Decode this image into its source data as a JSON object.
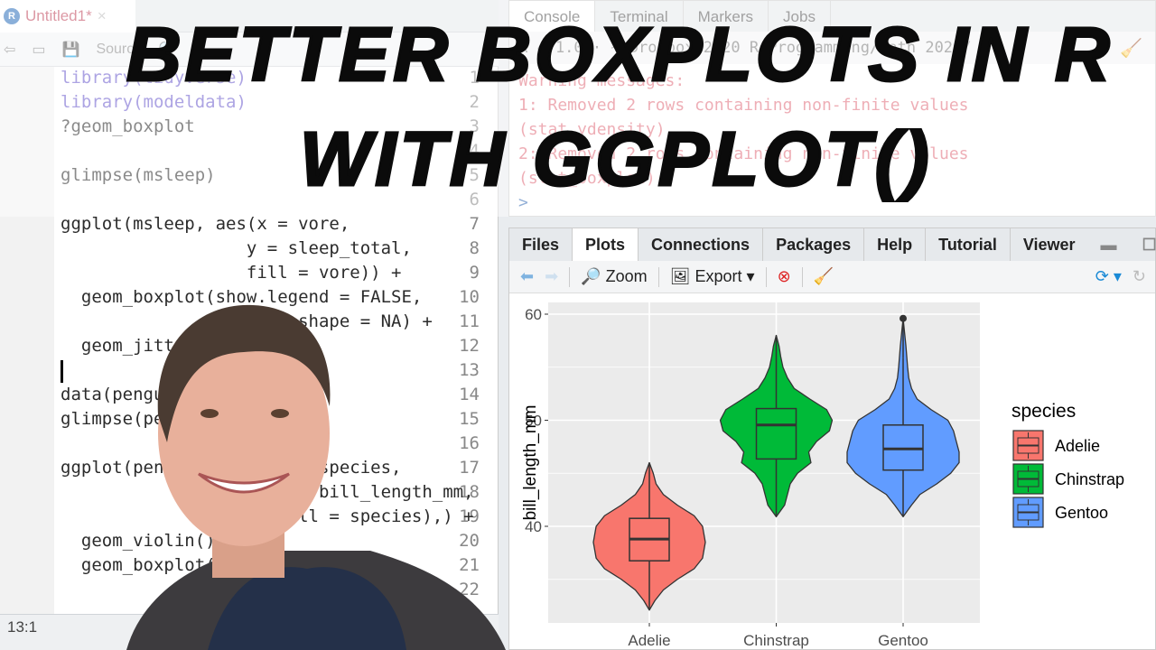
{
  "title": {
    "line1": "BETTER BOXPLOTS IN R",
    "line2": "WITH GGPLOT()"
  },
  "editor": {
    "tab_label": "Untitled1*",
    "r_icon": "R",
    "source_label": "Source",
    "lines": [
      {
        "n": "1",
        "code": "library(tidyverse)"
      },
      {
        "n": "2",
        "code": "library(modeldata)"
      },
      {
        "n": "3",
        "code": "?geom_boxplot"
      },
      {
        "n": "4",
        "code": ""
      },
      {
        "n": "5",
        "code": "glimpse(msleep)"
      },
      {
        "n": "6",
        "code": ""
      },
      {
        "n": "7",
        "code": "ggplot(msleep, aes(x = vore,"
      },
      {
        "n": "8",
        "code": "                  y = sleep_total,"
      },
      {
        "n": "9",
        "code": "                  fill = vore)) +"
      },
      {
        "n": "10",
        "code": "  geom_boxplot(show.legend = FALSE,"
      },
      {
        "n": "11",
        "code": "               outlier.shape = NA) +"
      },
      {
        "n": "12",
        "code": "  geom_jitter()"
      },
      {
        "n": "13",
        "code": ""
      },
      {
        "n": "14",
        "code": "data(penguins)"
      },
      {
        "n": "15",
        "code": "glimpse(penguins)"
      },
      {
        "n": "16",
        "code": ""
      },
      {
        "n": "17",
        "code": "ggplot(penguins, aes(x = species,"
      },
      {
        "n": "18",
        "code": "                     y = bill_length_mm,"
      },
      {
        "n": "19",
        "code": "                     fill = species),) +"
      },
      {
        "n": "20",
        "code": "  geom_violin() +"
      },
      {
        "n": "21",
        "code": "  geom_boxplot()"
      },
      {
        "n": "22",
        "code": ""
      }
    ],
    "cursor_position": "13:1"
  },
  "console": {
    "tabs": [
      "Console",
      "Terminal",
      "Markers",
      "Jobs"
    ],
    "path": "R 4.1.0 · ~/Dropbox/2020 R Programming/Math 2020/",
    "lines": [
      "Warning messages:",
      "1: Removed 2 rows containing non-finite values",
      "(stat_ydensity).",
      "2: Removed 2 rows containing non-finite values",
      "(stat_boxplot).",
      ">"
    ]
  },
  "plots_pane": {
    "tabs": [
      "Files",
      "Plots",
      "Connections",
      "Packages",
      "Help",
      "Tutorial",
      "Viewer"
    ],
    "active_tab": "Plots",
    "zoom_label": "Zoom",
    "export_label": "Export"
  },
  "chart_data": {
    "type": "violin+boxplot",
    "xlabel": "",
    "ylabel": "bill_length_mm",
    "ylim": [
      30.9,
      61.1
    ],
    "yticks": [
      "40",
      "50",
      "60"
    ],
    "legend": {
      "title": "species",
      "position": "right"
    },
    "categories": [
      "Adelie",
      "Chinstrap",
      "Gentoo"
    ],
    "colors": [
      "#F8766D",
      "#00BA38",
      "#619CFF"
    ],
    "series": [
      {
        "name": "Adelie",
        "min": 32.1,
        "q1": 36.75,
        "median": 38.8,
        "q3": 40.75,
        "max": 46.0,
        "outliers": [],
        "density": [
          [
            32.1,
            0
          ],
          [
            33,
            0.1
          ],
          [
            34,
            0.25
          ],
          [
            35,
            0.5
          ],
          [
            36,
            0.8
          ],
          [
            37,
            0.95
          ],
          [
            38.5,
            1
          ],
          [
            40,
            0.95
          ],
          [
            41,
            0.8
          ],
          [
            42,
            0.5
          ],
          [
            43,
            0.25
          ],
          [
            44,
            0.12
          ],
          [
            45,
            0.07
          ],
          [
            46,
            0
          ]
        ]
      },
      {
        "name": "Chinstrap",
        "min": 40.9,
        "q1": 46.35,
        "median": 49.55,
        "q3": 51.1,
        "max": 58.0,
        "outliers": [],
        "density": [
          [
            40.9,
            0
          ],
          [
            42,
            0.15
          ],
          [
            43,
            0.2
          ],
          [
            44,
            0.25
          ],
          [
            45,
            0.38
          ],
          [
            46,
            0.62
          ],
          [
            47,
            0.58
          ],
          [
            48,
            0.72
          ],
          [
            49,
            0.95
          ],
          [
            50,
            1
          ],
          [
            51,
            0.9
          ],
          [
            52,
            0.6
          ],
          [
            53,
            0.32
          ],
          [
            54,
            0.2
          ],
          [
            55,
            0.12
          ],
          [
            56,
            0.08
          ],
          [
            57,
            0.05
          ],
          [
            58,
            0
          ]
        ]
      },
      {
        "name": "Gentoo",
        "min": 40.9,
        "q1": 45.3,
        "median": 47.3,
        "q3": 49.55,
        "max": 55.9,
        "outliers": [
          59.6
        ],
        "density": [
          [
            40.9,
            0
          ],
          [
            42,
            0.15
          ],
          [
            43,
            0.3
          ],
          [
            44,
            0.6
          ],
          [
            45,
            0.85
          ],
          [
            46,
            1
          ],
          [
            47,
            1
          ],
          [
            48,
            0.95
          ],
          [
            49,
            0.9
          ],
          [
            50,
            0.8
          ],
          [
            51,
            0.5
          ],
          [
            52,
            0.25
          ],
          [
            53,
            0.15
          ],
          [
            54,
            0.1
          ],
          [
            55,
            0.08
          ],
          [
            57,
            0.05
          ],
          [
            59.6,
            0
          ]
        ]
      }
    ]
  }
}
